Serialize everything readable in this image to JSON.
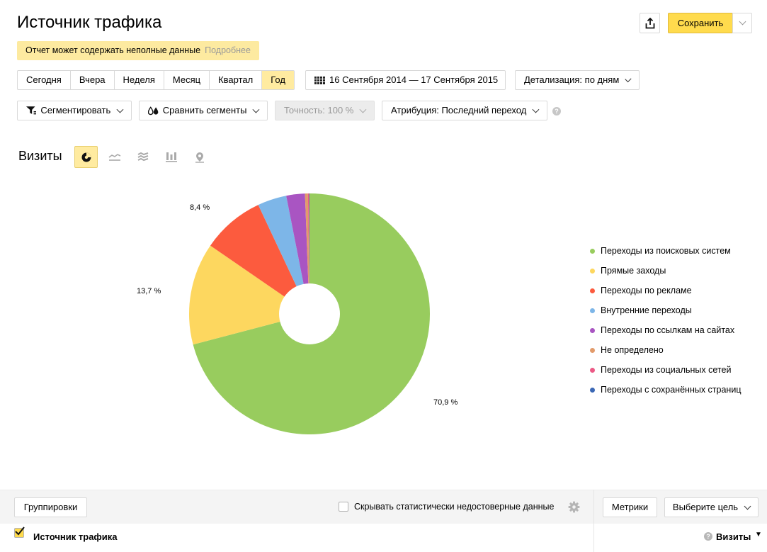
{
  "header": {
    "title": "Источник трафика",
    "save_label": "Сохранить"
  },
  "warning": {
    "text": "Отчет может содержать неполные данные",
    "more": "Подробнее"
  },
  "period": {
    "items": [
      "Сегодня",
      "Вчера",
      "Неделя",
      "Месяц",
      "Квартал",
      "Год"
    ],
    "active": "Год"
  },
  "date_range": "16 Сентября 2014 — 17 Сентября 2015",
  "detail_label": "Детализация: по дням",
  "toolbar": {
    "segment": "Сегментировать",
    "compare": "Сравнить сегменты",
    "accuracy": "Точность: 100 %",
    "attribution": "Атрибуция: Последний переход",
    "help": "?"
  },
  "chart_header": {
    "metric": "Визиты",
    "types": [
      "pie-chart-icon",
      "line-chart-icon",
      "area-chart-icon",
      "bar-chart-icon",
      "map-icon"
    ],
    "active_type": "pie-chart-icon"
  },
  "chart_data": {
    "type": "pie",
    "donut": true,
    "categories": [
      "Переходы из поисковых систем",
      "Прямые заходы",
      "Переходы по рекламе",
      "Внутренние переходы",
      "Переходы по ссылкам на сайтах",
      "Не определено",
      "Переходы из социальных сетей",
      "Переходы с сохранённых страниц"
    ],
    "values": [
      70.9,
      13.7,
      8.4,
      3.9,
      2.5,
      0.4,
      0.15,
      0.05
    ],
    "value_labels": [
      "70,9 %",
      "13,7 %",
      "8,4 %",
      "",
      "",
      "",
      "",
      ""
    ],
    "colors": [
      "#98cc5e",
      "#fdd75f",
      "#fc5b3e",
      "#7db6e8",
      "#a955c2",
      "#e29b6b",
      "#ec5a86",
      "#3b68b5"
    ],
    "legend_position": "right"
  },
  "bottom": {
    "groupings": "Группировки",
    "hide_unreliable": "Скрывать статистически недостоверные данные",
    "metrics": "Метрики",
    "goal": "Выберите цель",
    "row_label": "Источник трафика",
    "row_metric": "Визиты",
    "help": "?"
  }
}
